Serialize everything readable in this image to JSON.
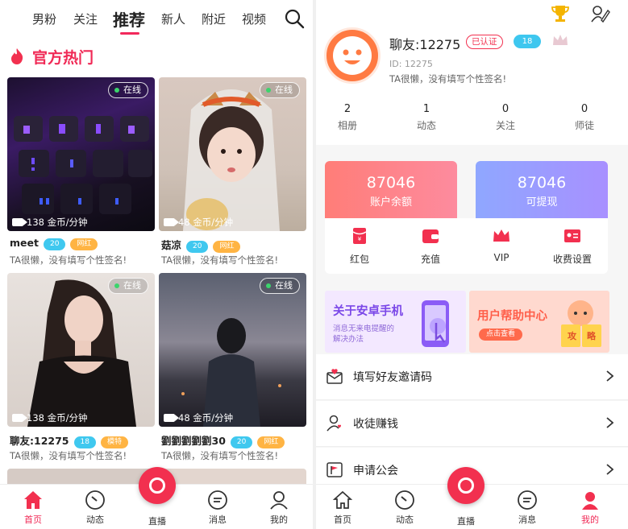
{
  "left": {
    "tabs": [
      "男粉",
      "关注",
      "推荐",
      "新人",
      "附近",
      "视频"
    ],
    "active_tab": "推荐",
    "section_title": "官方热门",
    "cards": [
      {
        "online": "在线",
        "price": "138 金币/分钟",
        "name": "meet",
        "level": "20",
        "tag": "网红",
        "signature": "TA很懒，没有填写个性签名!"
      },
      {
        "online": "在线",
        "price": "48 金币/分钟",
        "name": "菇凉",
        "level": "20",
        "tag": "网红",
        "signature": "TA很懒，没有填写个性签名!"
      },
      {
        "online": "在线",
        "price": "138 金币/分钟",
        "name": "聊友:12275",
        "level": "18",
        "tag": "模特",
        "signature": "TA很懒，没有填写个性签名!"
      },
      {
        "online": "在线",
        "price": "48 金币/分钟",
        "name": "劉劉劉劉劉30",
        "level": "20",
        "tag": "网红",
        "signature": "TA很懒，没有填写个性签名!"
      }
    ],
    "nav": [
      "首页",
      "动态",
      "直播",
      "消息",
      "我的"
    ]
  },
  "right": {
    "username": "聊友:12275",
    "verified": "已认证",
    "level": "18",
    "id_text": "ID: 12275",
    "signature": "TA很懒，没有填写个性签名!",
    "stats": [
      {
        "value": "2",
        "label": "相册"
      },
      {
        "value": "1",
        "label": "动态"
      },
      {
        "value": "0",
        "label": "关注"
      },
      {
        "value": "0",
        "label": "师徒"
      }
    ],
    "balance": {
      "value": "87046",
      "label": "账户余额"
    },
    "withdrawable": {
      "value": "87046",
      "label": "可提现"
    },
    "actions": [
      "红包",
      "充值",
      "VIP",
      "收费设置"
    ],
    "banner1": {
      "title": "关于安卓手机",
      "sub1": "消息无来电提醒的",
      "sub2": "解决办法"
    },
    "banner2": {
      "title": "用户帮助中心",
      "button": "点击查看",
      "book1": "攻",
      "book2": "略"
    },
    "menu": [
      "填写好友邀请码",
      "收徒赚钱",
      "申请公会"
    ],
    "nav": [
      "首页",
      "动态",
      "直播",
      "消息",
      "我的"
    ]
  },
  "colors": {
    "accent": "#f2295b",
    "blue_badge": "#3fc8ef",
    "orange_badge": "#ffb443",
    "balance_card": "#ff7d78",
    "withdraw_card": "#a890ff"
  }
}
